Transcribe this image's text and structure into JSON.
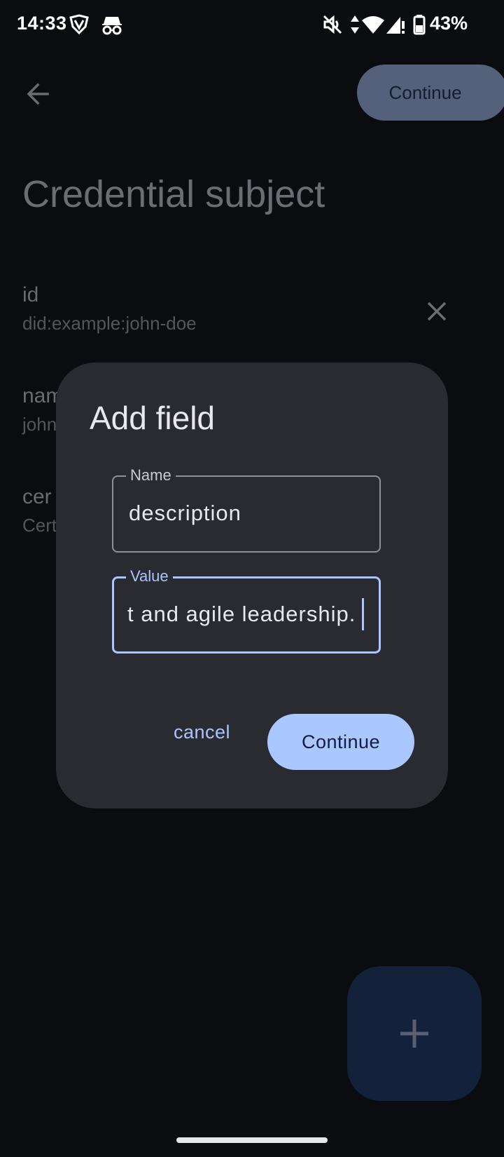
{
  "status_bar": {
    "time": "14:33",
    "battery_text": "43%",
    "icons": [
      "vpn-shield-icon",
      "incognito-icon",
      "mute-icon",
      "data-arrows-icon",
      "wifi-icon",
      "signal-icon",
      "battery-icon"
    ]
  },
  "header": {
    "continue_label": "Continue"
  },
  "page": {
    "title": "Credential subject",
    "fields": [
      {
        "name": "id",
        "value": "did:example:john-doe"
      },
      {
        "name": "nam",
        "value": "john"
      },
      {
        "name": "cer",
        "value": "Cert"
      }
    ]
  },
  "dialog": {
    "title": "Add field",
    "name_field": {
      "label": "Name",
      "value": "description"
    },
    "value_field": {
      "label": "Value",
      "value": "t and agile leadership."
    },
    "cancel_label": "cancel",
    "continue_label": "Continue"
  },
  "colors": {
    "background": "#0b0c10",
    "dialog": "#2a2b31",
    "accent": "#aac4ff",
    "fab": "#14213a"
  }
}
